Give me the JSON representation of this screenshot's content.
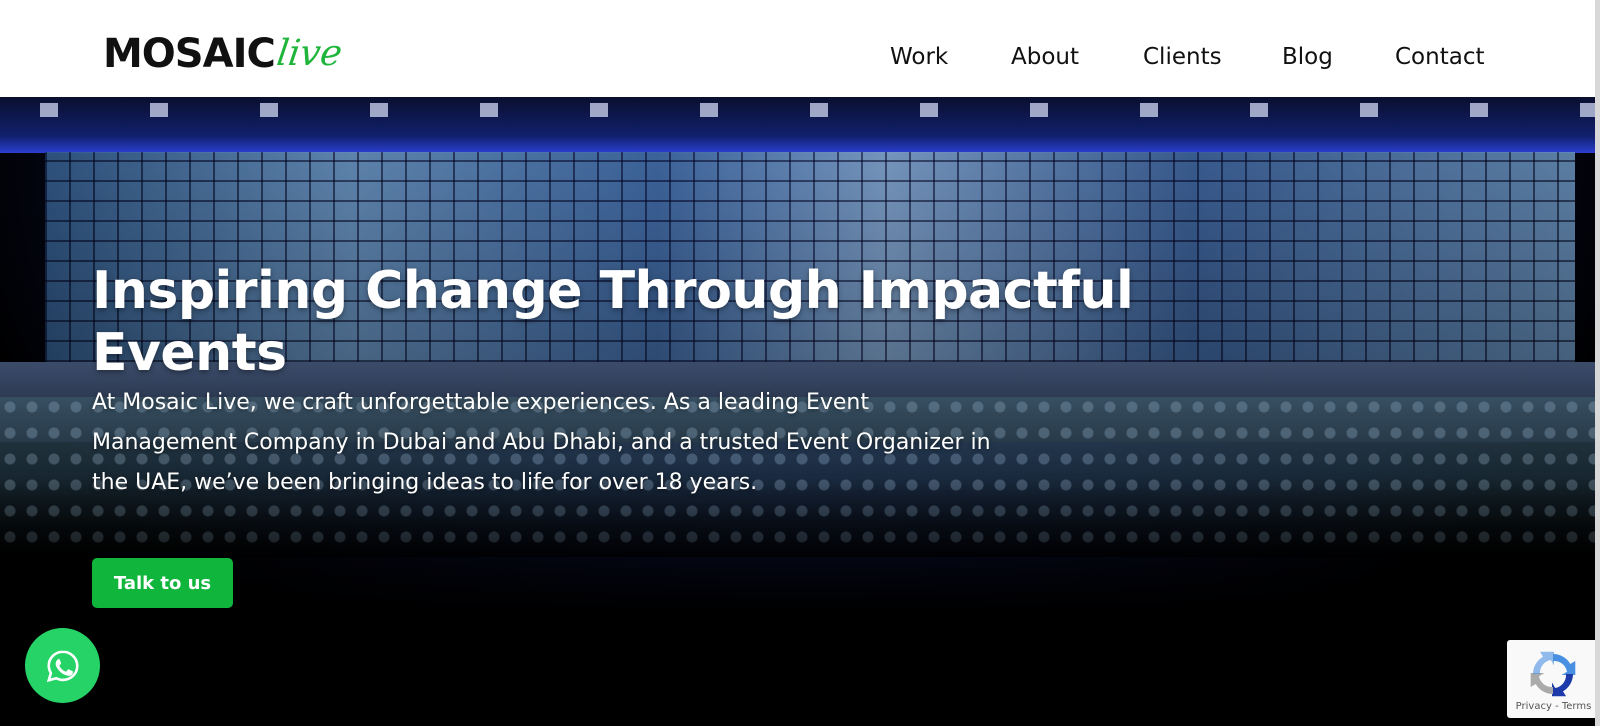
{
  "header": {
    "logo_main": "MOSAIC",
    "logo_script": "live",
    "nav": [
      {
        "label": "Work"
      },
      {
        "label": "About"
      },
      {
        "label": "Clients"
      },
      {
        "label": "Blog"
      },
      {
        "label": "Contact"
      }
    ]
  },
  "hero": {
    "title": "Inspiring Change Through Impactful Events",
    "description": "At Mosaic Live, we craft unforgettable experiences. As a leading Event Management Company in Dubai and Abu Dhabi, and a trusted Event Organizer in the UAE, we’ve been bringing ideas to life for over 18 years.",
    "cta_label": "Talk to us"
  },
  "recaptcha": {
    "privacy": "Privacy",
    "separator": " - ",
    "terms": "Terms"
  },
  "colors": {
    "brand_green": "#10b53c",
    "whatsapp_green": "#25d366",
    "logo_green": "#1fb53a"
  },
  "icons": {
    "whatsapp": "whatsapp-icon",
    "recaptcha": "recaptcha-icon"
  }
}
